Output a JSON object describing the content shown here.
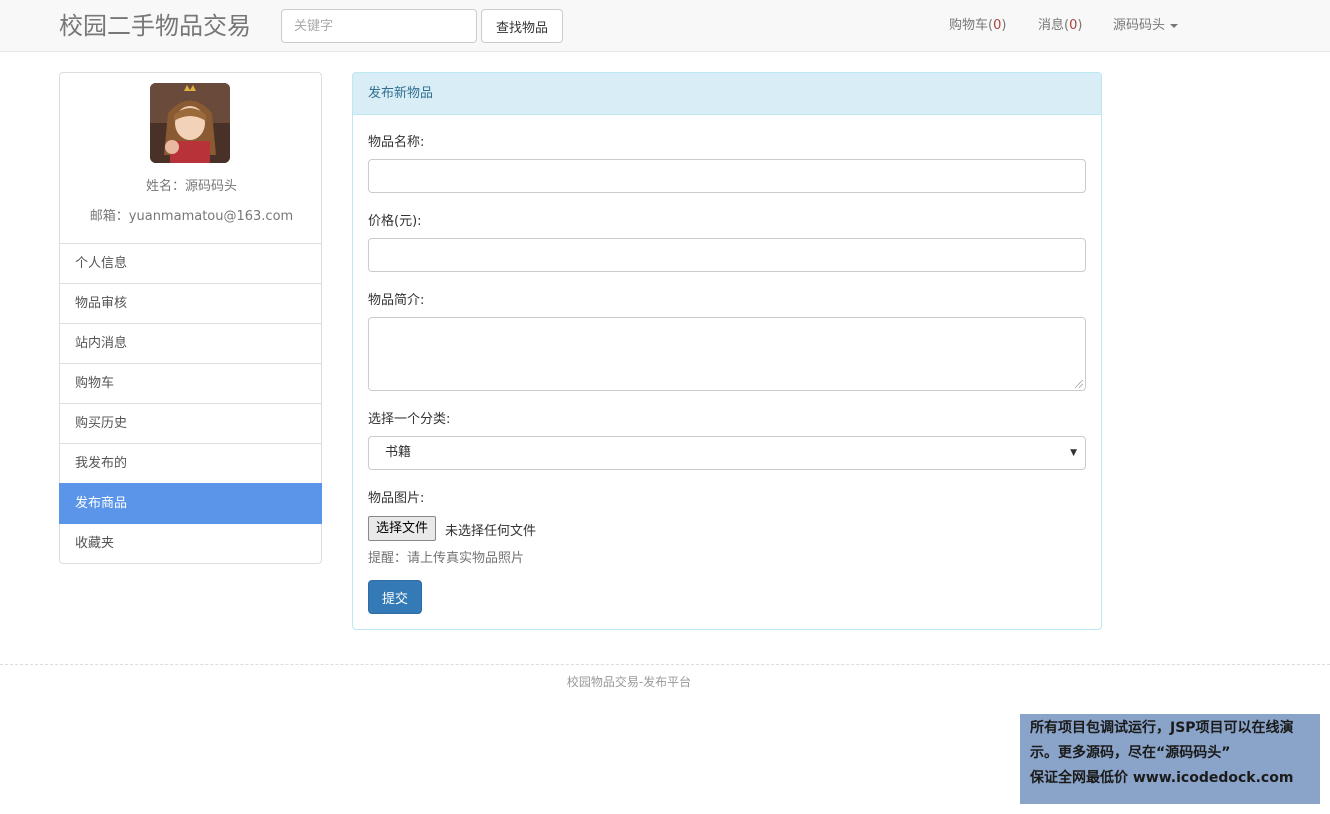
{
  "navbar": {
    "brand": "校园二手物品交易",
    "search_placeholder": "关键字",
    "search_button": "查找物品",
    "cart_label": "购物车(",
    "cart_count": "0",
    "cart_close": ")",
    "msg_label": "消息(",
    "msg_count": "0",
    "msg_close": ")",
    "user_menu": "源码码头"
  },
  "profile": {
    "name": "姓名：源码码头",
    "email": "邮箱：yuanmamatou@163.com"
  },
  "sidebar": {
    "items": [
      {
        "label": "个人信息"
      },
      {
        "label": "物品审核"
      },
      {
        "label": "站内消息"
      },
      {
        "label": "购物车"
      },
      {
        "label": "购买历史"
      },
      {
        "label": "我发布的"
      },
      {
        "label": "发布商品",
        "active": true
      },
      {
        "label": "收藏夹"
      }
    ]
  },
  "form": {
    "heading": "发布新物品",
    "name_label": "物品名称:",
    "name_value": "",
    "price_label": "价格(元):",
    "price_value": "",
    "desc_label": "物品简介:",
    "desc_value": "",
    "category_label": "选择一个分类:",
    "category_value": "书籍",
    "image_label": "物品图片:",
    "file_button": "选择文件",
    "file_status": "未选择任何文件",
    "hint": "提醒：请上传真实物品照片",
    "submit": "提交"
  },
  "footer": {
    "text": "校园物品交易-发布平台"
  },
  "watermark": {
    "line1": "所有项目包调试运行，JSP项目可以在线演",
    "line2": "示。更多源码，尽在“源码码头”",
    "line3": "保证全网最低价 www.icodedock.com"
  },
  "colors": {
    "accent": "#337ab7",
    "active_menu": "#5b95e9",
    "panel_heading": "#d9edf7"
  }
}
